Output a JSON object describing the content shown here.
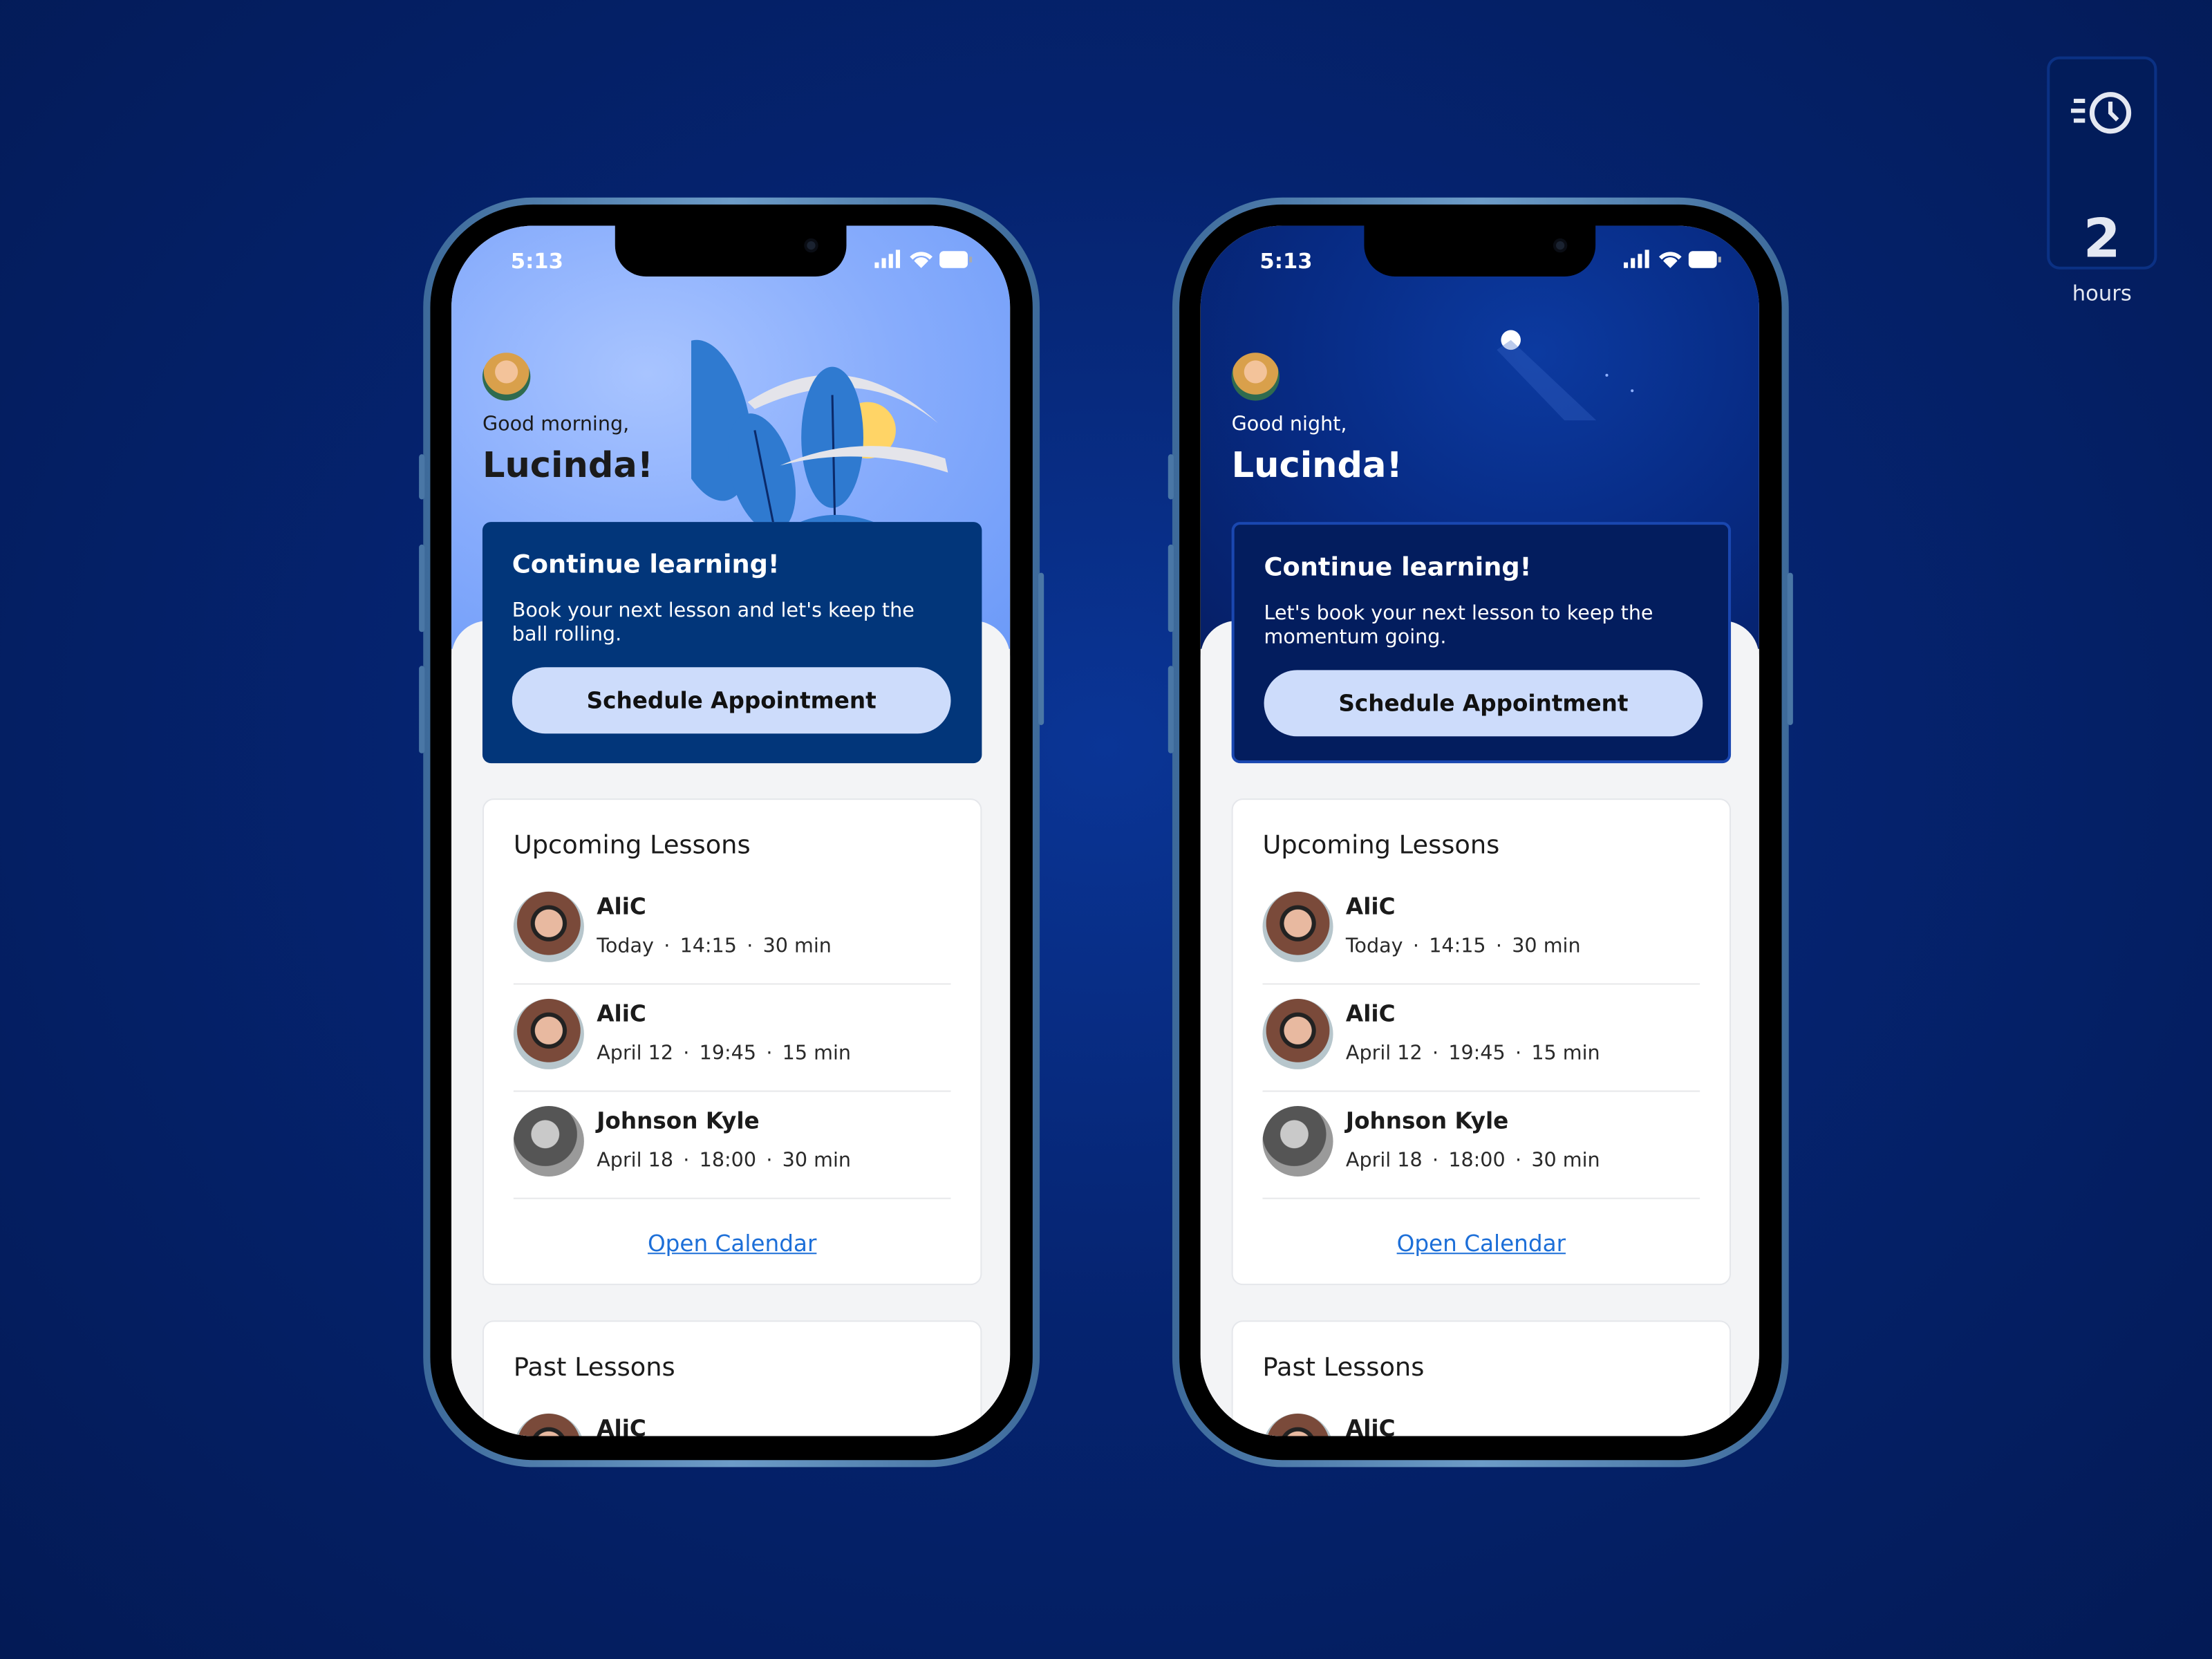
{
  "duration_badge": {
    "icon": "clock-fast-icon",
    "value": "2",
    "unit": "hours"
  },
  "phones": [
    {
      "theme": "day",
      "status_time": "5:13",
      "greeting": "Good morning,",
      "user_name": "Lucinda!",
      "cta": {
        "title": "Continue learning!",
        "body": "Book your next lesson and let's keep the ball rolling.",
        "button": "Schedule Appointment"
      }
    },
    {
      "theme": "night",
      "status_time": "5:13",
      "greeting": "Good night,",
      "user_name": "Lucinda!",
      "cta": {
        "title": "Continue learning!",
        "body": "Let's book your next lesson to keep the momentum going.",
        "button": "Schedule Appointment"
      }
    }
  ],
  "upcoming": {
    "title": "Upcoming Lessons",
    "link": "Open Calendar",
    "lessons": [
      {
        "name": "AliC",
        "date": "Today",
        "time": "14:15",
        "duration": "30 min"
      },
      {
        "name": "AliC",
        "date": "April 12",
        "time": "19:45",
        "duration": "15 min"
      },
      {
        "name": "Johnson Kyle",
        "date": "April 18",
        "time": "18:00",
        "duration": "30 min"
      }
    ]
  },
  "past": {
    "title": "Past Lessons",
    "lessons": [
      {
        "name": "AliC"
      }
    ]
  },
  "colors": {
    "accent": "#1d6fd8",
    "cta_day": "#02367a",
    "cta_night": "#031d5e",
    "button": "#cddcfb"
  }
}
